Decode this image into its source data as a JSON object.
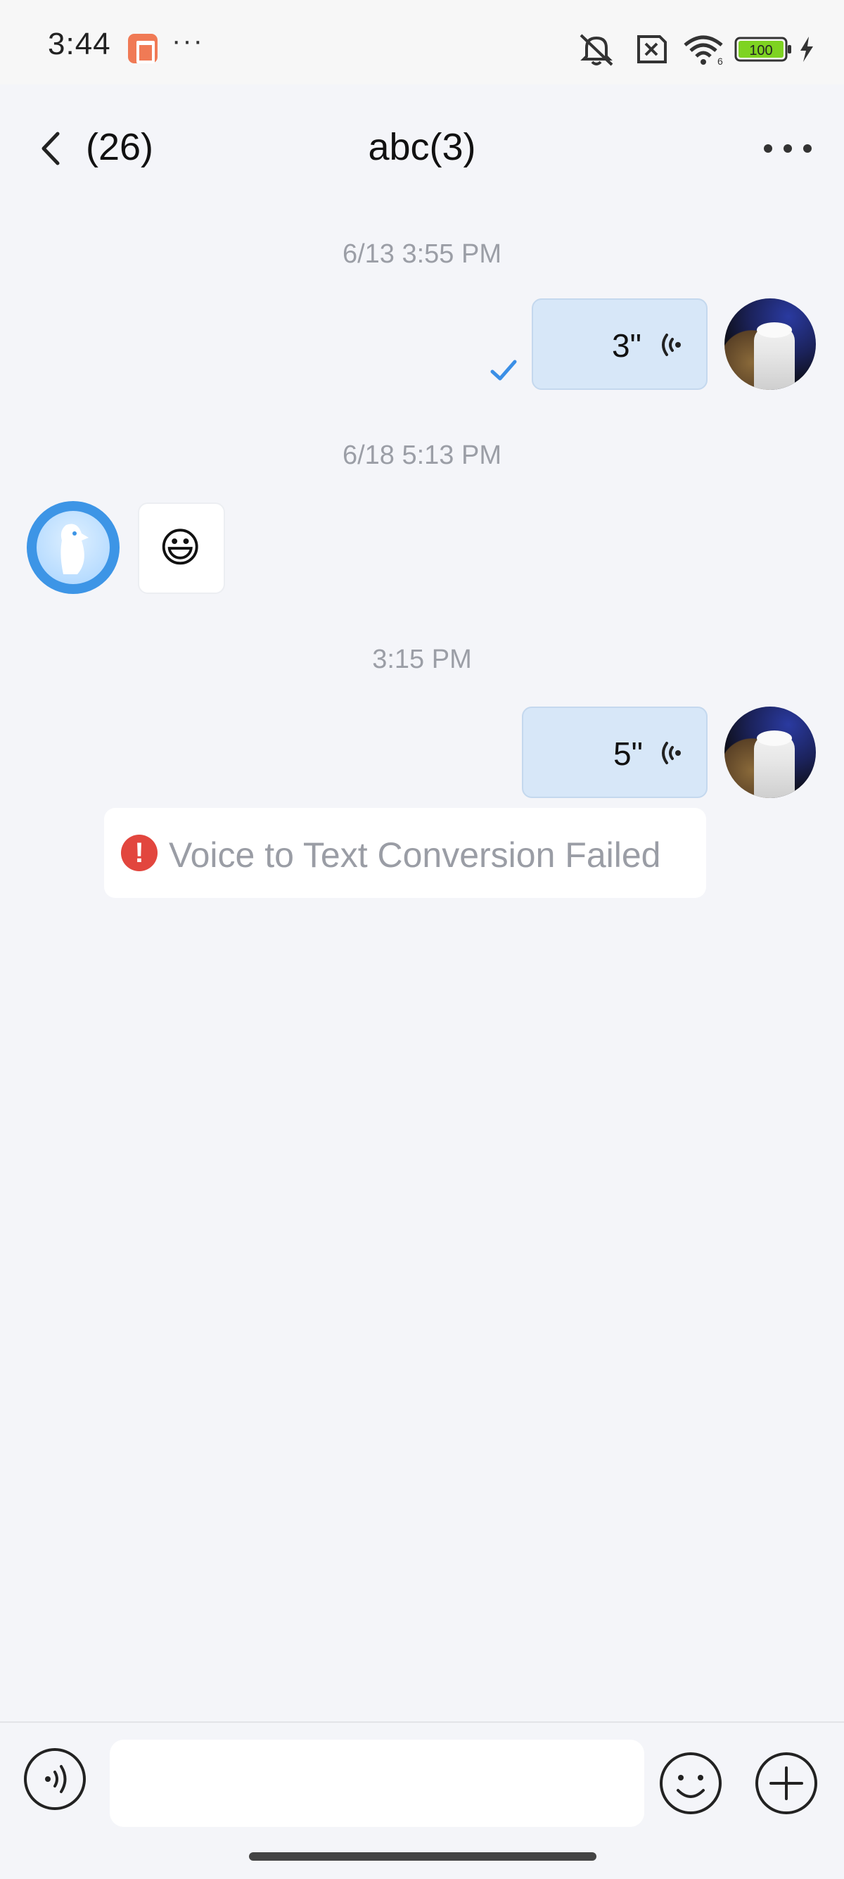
{
  "status_bar": {
    "time": "3:44",
    "dots": "···",
    "battery": "100",
    "icons": [
      "app-notification-icon",
      "mute-icon",
      "no-sim-icon",
      "wifi-icon",
      "battery-icon",
      "charging-icon"
    ]
  },
  "header": {
    "back_count": "(26)",
    "title": "abc(3)"
  },
  "messages": [
    {
      "timestamp": "6/13 3:55 PM"
    },
    {
      "duration": "3\""
    },
    {
      "timestamp": "6/18 5:13 PM"
    },
    {
      "emoji": "😃"
    },
    {
      "timestamp": "3:15 PM"
    },
    {
      "duration": "5\""
    },
    {
      "error_text": "Voice to Text Conversion Failed",
      "error_icon": "!"
    }
  ],
  "colors": {
    "voice_bubble": "#d7e7f8",
    "check": "#3b8fe6",
    "error": "#e2463e"
  }
}
